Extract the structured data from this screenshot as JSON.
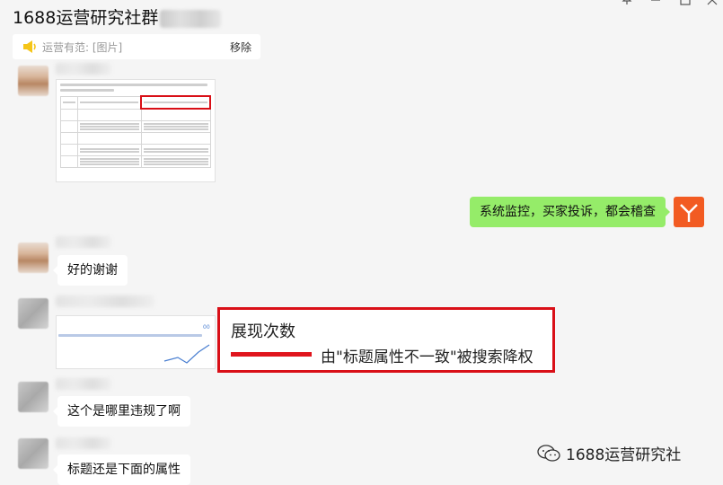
{
  "window": {
    "title": "1688运营研究社群",
    "pin_icon": "pin-icon",
    "minimize_icon": "minimize-icon",
    "maximize_icon": "maximize-icon",
    "close_icon": "close-icon"
  },
  "notice": {
    "label": "运营有范: [图片]",
    "remove": "移除",
    "icon": "speaker-icon"
  },
  "messages": [
    {
      "from": "other",
      "type": "image",
      "content": "document-table-screenshot"
    },
    {
      "from": "me",
      "type": "text",
      "text": "系统监控，买家投诉，都会稽查"
    },
    {
      "from": "other",
      "type": "text",
      "text": "好的谢谢"
    },
    {
      "from": "other",
      "type": "image",
      "content": "trend-chart-screenshot"
    },
    {
      "from": "other",
      "type": "text",
      "text": "这个是哪里违规了啊"
    },
    {
      "from": "other",
      "type": "text",
      "text": "标题还是下面的属性"
    }
  ],
  "callout": {
    "title": "展现次数",
    "text": "由\"标题属性不一致\"被搜索降权",
    "accent": "#d90f17"
  },
  "watermark": {
    "text": "1688运营研究社",
    "icon": "wechat-icon"
  },
  "colors": {
    "my_bubble": "#95ec69",
    "background": "#f5f5f5",
    "my_avatar": "#f25b22"
  }
}
